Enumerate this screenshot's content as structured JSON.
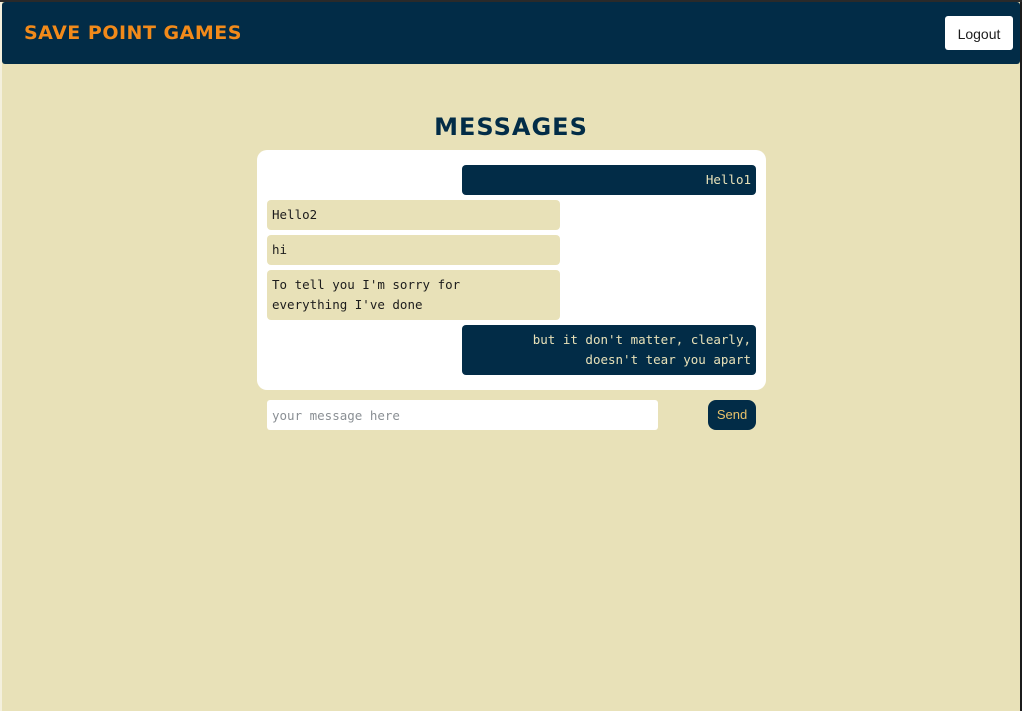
{
  "header": {
    "brand": "Save Point Games",
    "logout_label": "Logout"
  },
  "page": {
    "title": "Messages"
  },
  "messages": [
    {
      "text": "Hello1",
      "direction": "sent"
    },
    {
      "text": "Hello2",
      "direction": "received"
    },
    {
      "text": "hi",
      "direction": "received"
    },
    {
      "text": "To tell you I'm sorry for everything I've done",
      "direction": "received"
    },
    {
      "text": "but it don't matter, clearly, doesn't tear you apart",
      "direction": "sent"
    }
  ],
  "composer": {
    "placeholder": "your message here",
    "value": "",
    "send_label": "Send"
  },
  "colors": {
    "navy": "#022c47",
    "cream": "#e8e1b8",
    "brand_orange": "#f28a1a",
    "send_text": "#e9c26a"
  }
}
